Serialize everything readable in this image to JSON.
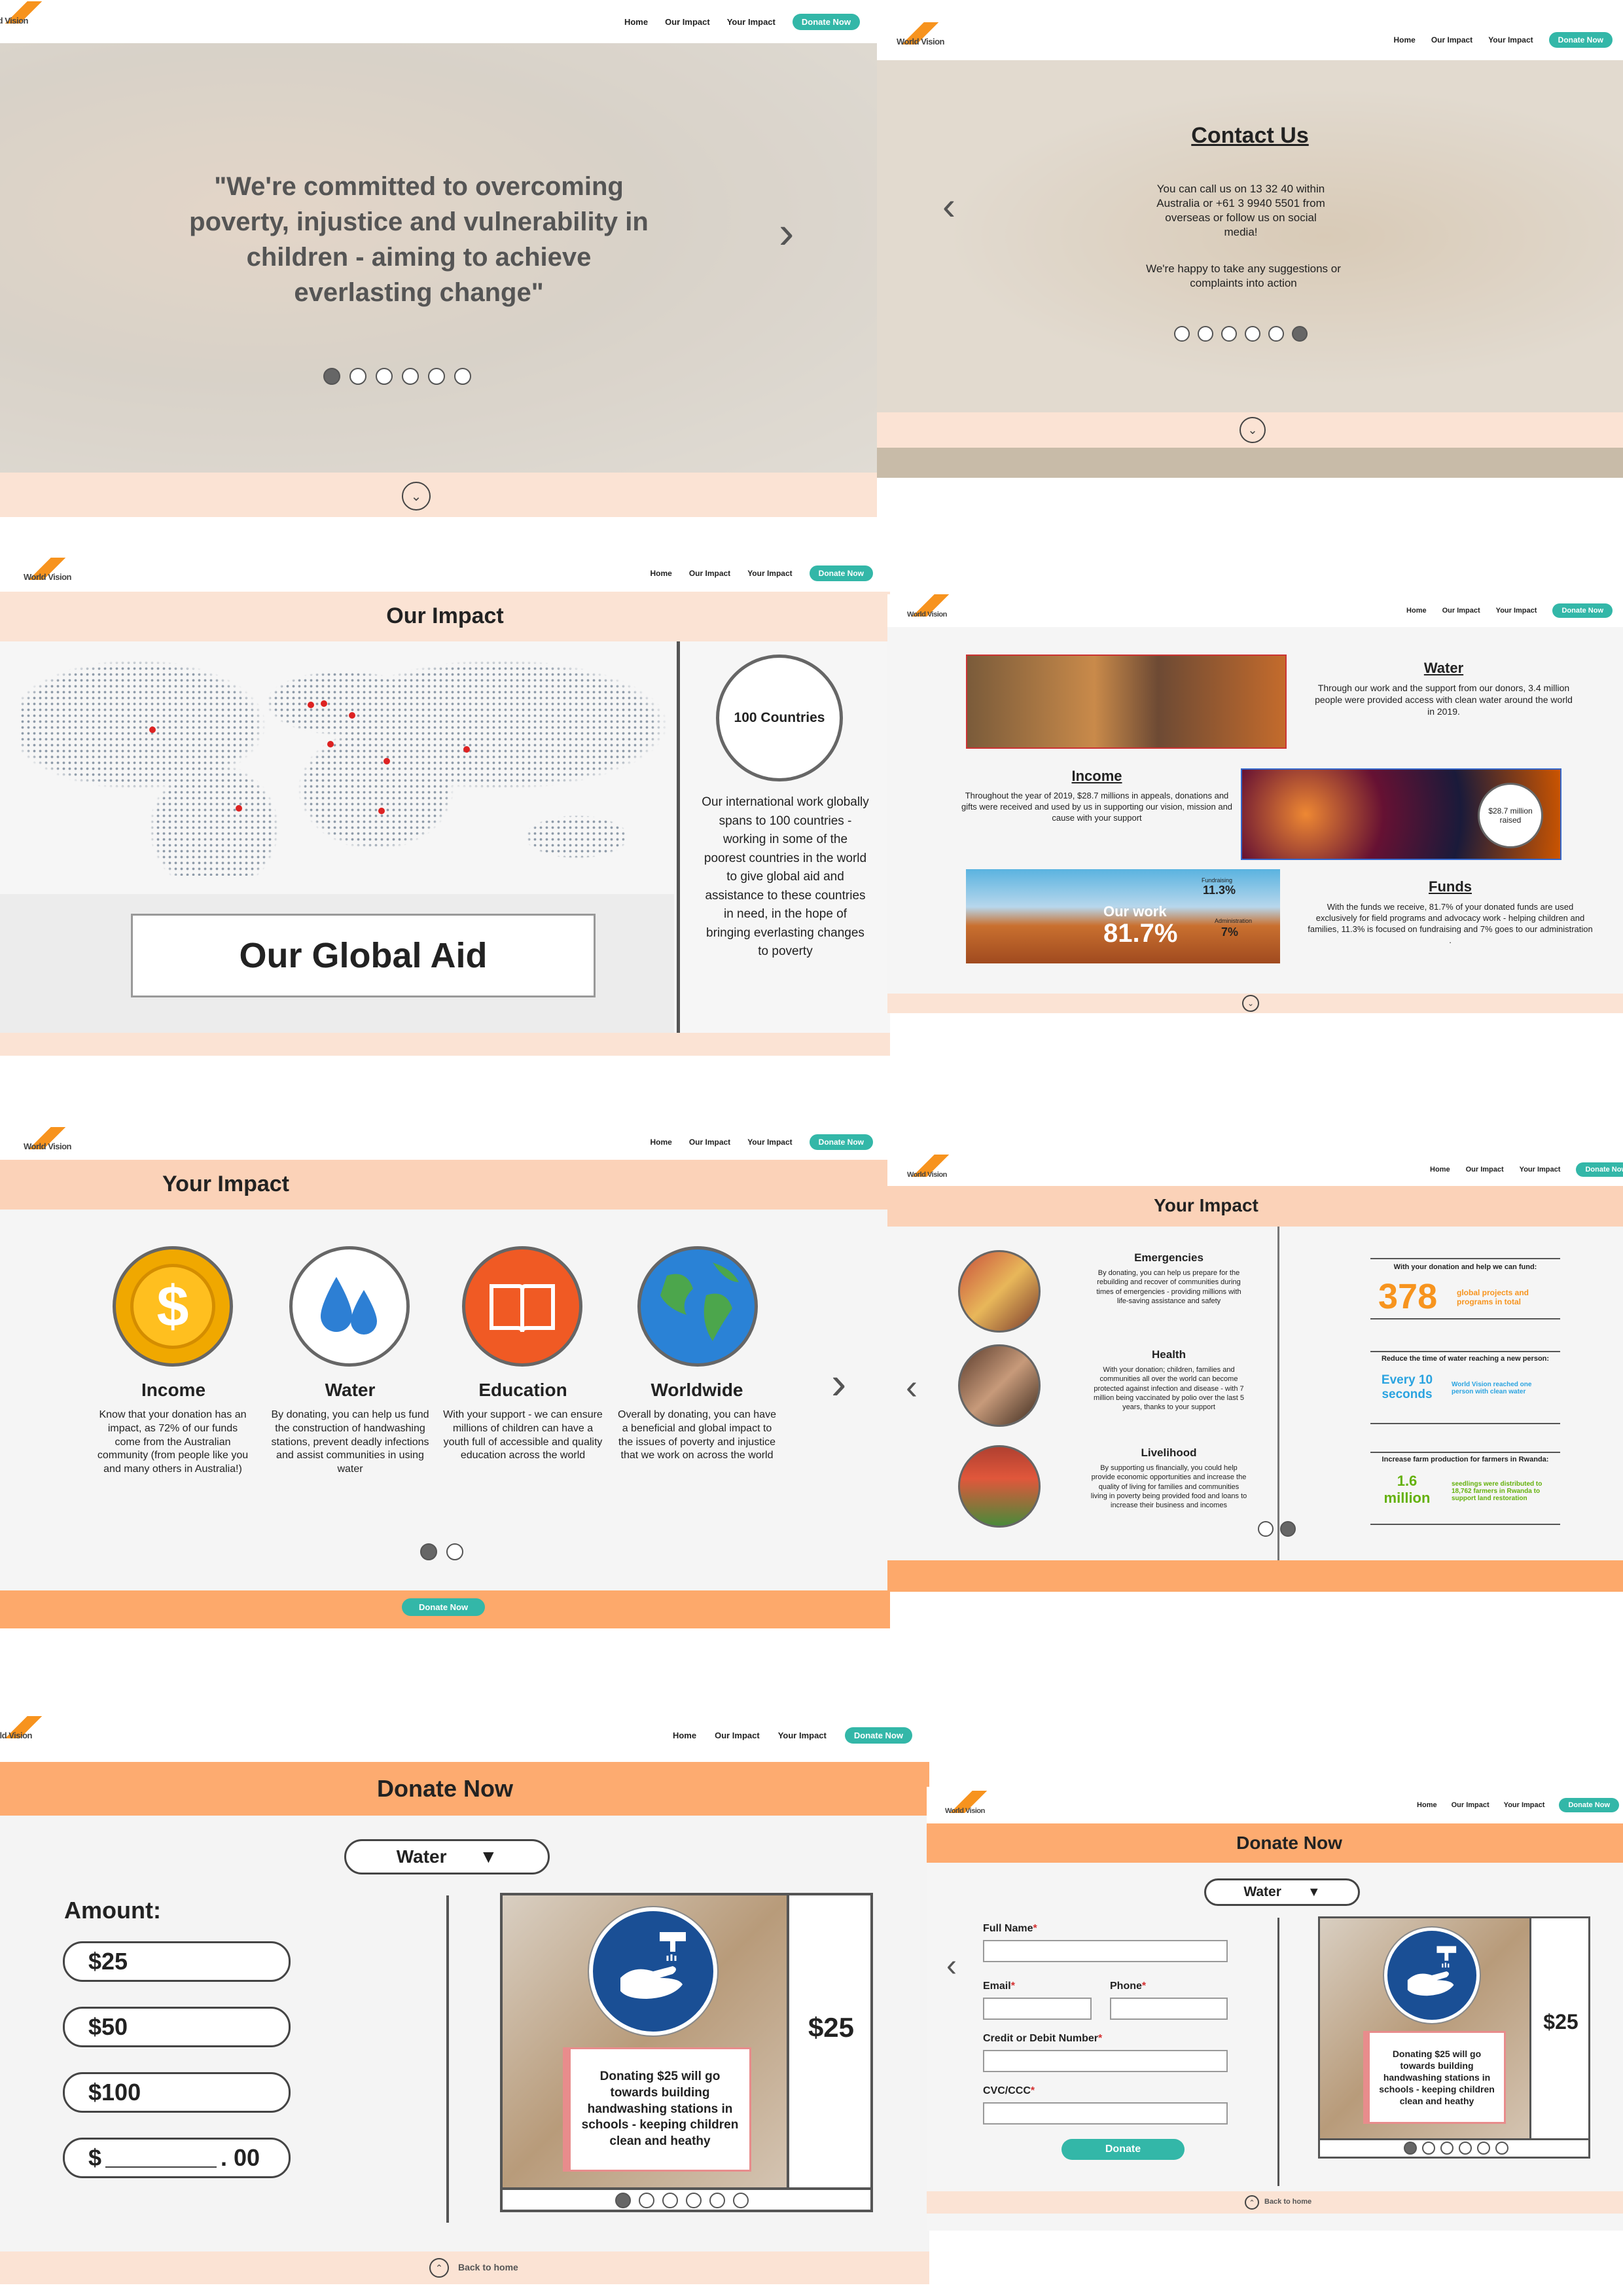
{
  "nav": {
    "home": "Home",
    "our_impact": "Our Impact",
    "your_impact": "Your Impact",
    "donate": "Donate Now"
  },
  "logo": {
    "text": "World Vision"
  },
  "hero": {
    "quote": "\"We're committed to overcoming poverty, injustice and vulnerability in children - aiming to achieve everlasting change\""
  },
  "contact": {
    "title": "Contact Us",
    "line1": "You can call us on 13 32 40 within Australia or +61 3 9940 5501 from overseas or follow us on social media!",
    "line2": "We're happy to take any suggestions or complaints into action"
  },
  "our_impact": {
    "title": "Our Impact",
    "countries": "100 Countries",
    "desc": "Our international work globally spans to 100 countries -  working in some of the poorest countries in the world to give global aid and assistance to these countries in need, in the hope of bringing everlasting changes to poverty",
    "global_aid": "Our Global Aid"
  },
  "funds": {
    "water_title": "Water",
    "water_text": "Through our work and the support from our donors, 3.4 million people were provided access with clean water around the world in 2019.",
    "income_title": "Income",
    "income_text": "Throughout the year of 2019, $28.7 millions in appeals, donations and gifts were received and used by us in supporting our vision, mission and cause with your support",
    "raised": "$28.7 million raised",
    "funds_title": "Funds",
    "funds_text": "With the funds we receive, 81.7% of your donated funds are used exclusively for field programs and advocacy work - helping children and families, 11.3% is focused on fundraising and 7% goes to our administration .",
    "our_work_label": "Our work",
    "our_work_pct": "81.7%",
    "fundraising_label": "Fundraising",
    "fundraising_pct": "11.3%",
    "admin_label": "Administration",
    "admin_pct": "7%"
  },
  "your_impact": {
    "title": "Your Impact",
    "items": [
      {
        "title": "Income",
        "text": "Know that your donation has an impact, as 72% of our funds come from the Australian community (from people like you and many others in Australia!)"
      },
      {
        "title": "Water",
        "text": "By donating, you can help us fund the construction of handwashing stations, prevent deadly infections and assist communities in using water"
      },
      {
        "title": "Education",
        "text": "With your support - we can ensure millions of children can have a youth full of accessible and quality education across the world"
      },
      {
        "title": "Worldwide",
        "text": "Overall by donating, you can have a beneficial and global impact to the issues of poverty and injustice that we work on across the world"
      }
    ],
    "donate": "Donate Now"
  },
  "your_impact2": {
    "title": "Your Impact",
    "items": [
      {
        "title": "Emergencies",
        "text": "By donating, you can help us prepare for the rebuilding and recover of communities during times of emergencies - providing millions with life-saving assistance and safety"
      },
      {
        "title": "Health",
        "text": "With your donation; children, families and communities all over the world can become protected against infection and disease - with 7 million being vaccinated by polio over the last 5 years, thanks to your support"
      },
      {
        "title": "Livelihood",
        "text": "By supporting us financially, you could help provide economic opportunities and increase the quality of living for families and communities living in poverty being provided food and loans to increase their business and incomes"
      }
    ],
    "stat1_head": "With your donation and help we can fund:",
    "stat1_num": "378",
    "stat1_text": "global projects and programs in total",
    "stat2_head": "Reduce the time of water reaching a new person:",
    "stat2_num": "Every 10 seconds",
    "stat2_text": "World Vision reached one person with clean water",
    "stat3_head": "Increase farm production for farmers in Rwanda:",
    "stat3_num": "1.6 million",
    "stat3_text": "seedlings were distributed to 18,762 farmers in Rwanda to support land restoration"
  },
  "donate": {
    "title": "Donate Now",
    "select": "Water",
    "amount_label": "Amount:",
    "amounts": [
      "$25",
      "$50",
      "$100",
      "$"
    ],
    "custom_suffix": ". 00",
    "card_text": "Donating $25 will go towards building handwashing stations in schools - keeping children clean and heathy",
    "card_price": "$25",
    "back": "Back to home"
  },
  "donate2": {
    "title": "Donate Now",
    "select": "Water",
    "full_name": "Full Name",
    "email": "Email",
    "phone": "Phone",
    "card": "Credit or Debit Number",
    "cvc": "CVC/CCC",
    "submit": "Donate",
    "card_text": "Donating $25 will go towards building handwashing stations in schools - keeping children clean and heathy",
    "card_price": "$25",
    "back": "Back to home"
  },
  "colors": {
    "teal": "#33b7a8",
    "orange": "#f7931e",
    "peach": "#fbe3d4",
    "salmon": "#fda96b"
  }
}
